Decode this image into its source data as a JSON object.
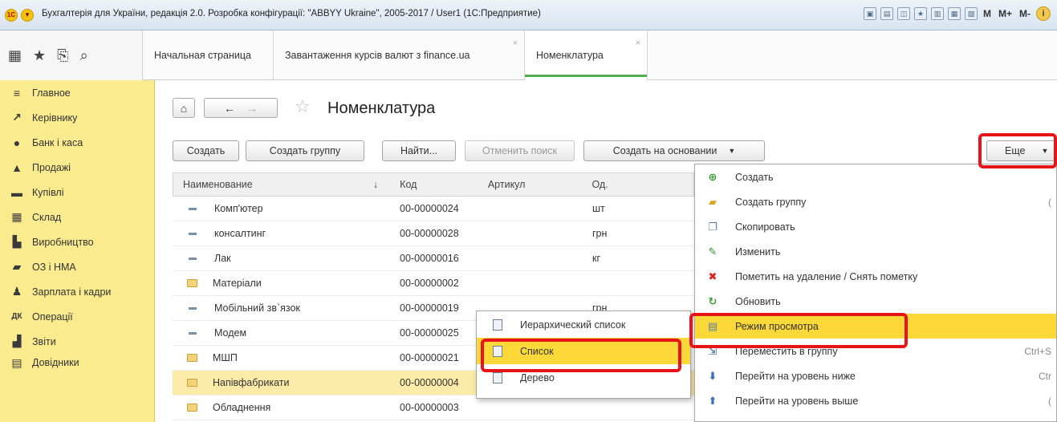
{
  "window": {
    "title": "Бухгалтерія для України, редакція 2.0. Розробка конфігурації: \"ABBYY Ukraine\", 2005-2017 / User1  (1С:Предприятие)",
    "logo_text": "1С",
    "toolbar_text": [
      "M",
      "M+",
      "M-"
    ],
    "info_icon": "i"
  },
  "tabs": [
    {
      "label": "Начальная страница",
      "closable": false
    },
    {
      "label": "Завантаження курсів валют з finance.ua",
      "closable": true
    },
    {
      "label": "Номенклатура",
      "closable": true,
      "active": true
    }
  ],
  "tab_close": "×",
  "sidebar": {
    "items": [
      {
        "label": "Главное",
        "icon": "menu-icon"
      },
      {
        "label": "Керівнику",
        "icon": "chart-icon"
      },
      {
        "label": "Банк і каса",
        "icon": "bank-icon"
      },
      {
        "label": "Продажі",
        "icon": "shopping-bag-icon"
      },
      {
        "label": "Купівлі",
        "icon": "cart-icon"
      },
      {
        "label": "Склад",
        "icon": "warehouse-icon"
      },
      {
        "label": "Виробництво",
        "icon": "factory-icon"
      },
      {
        "label": "ОЗ і НМА",
        "icon": "truck-icon"
      },
      {
        "label": "Зарплата і кадри",
        "icon": "person-icon"
      },
      {
        "label": "Операції",
        "icon": "operations-icon"
      },
      {
        "label": "Звіти",
        "icon": "report-icon"
      },
      {
        "label": "Довідники",
        "icon": "book-icon"
      }
    ]
  },
  "page": {
    "title": "Номенклатура",
    "home_glyph": "⌂",
    "back_glyph": "←",
    "forward_glyph": "→",
    "star_glyph": "☆"
  },
  "toolbar": {
    "create": "Создать",
    "create_group": "Создать группу",
    "find": "Найти...",
    "cancel_search": "Отменить поиск",
    "create_based_on": "Создать на основании",
    "more": "Еще",
    "dropdown_glyph": "▼"
  },
  "table": {
    "columns": {
      "name": "Наименование",
      "sort_glyph": "↓",
      "code": "Код",
      "article": "Артикул",
      "unit": "Од."
    },
    "rows": [
      {
        "type": "item",
        "name": "Комп'ютер",
        "code": "00-00000024",
        "article": "",
        "unit": "шт"
      },
      {
        "type": "item",
        "name": "консалтинг",
        "code": "00-00000028",
        "article": "",
        "unit": "грн"
      },
      {
        "type": "item",
        "name": "Лак",
        "code": "00-00000016",
        "article": "",
        "unit": "кг"
      },
      {
        "type": "folder",
        "name": "Матеріали",
        "code": "00-00000002",
        "article": "",
        "unit": ""
      },
      {
        "type": "item",
        "name": "Мобільний зв`язок",
        "code": "00-00000019",
        "article": "",
        "unit": "грн"
      },
      {
        "type": "item",
        "name": "Модем",
        "code": "00-00000025",
        "article": "",
        "unit": ""
      },
      {
        "type": "folder",
        "name": "МШП",
        "code": "00-00000021",
        "article": "",
        "unit": ""
      },
      {
        "type": "folder",
        "name": "Напівфабрикати",
        "code": "00-00000004",
        "article": "",
        "unit": "",
        "selected": true
      },
      {
        "type": "folder",
        "name": "Обладнення",
        "code": "00-00000003",
        "article": "",
        "unit": ""
      }
    ]
  },
  "view_menu": {
    "items": [
      {
        "label": "Иерархический список"
      },
      {
        "label": "Список",
        "highlighted": true
      },
      {
        "label": "Дерево"
      }
    ]
  },
  "more_menu": {
    "items": [
      {
        "label": "Создать",
        "icon": "plus-circle-icon",
        "glyph": "⊕",
        "color": "#3b9b3b",
        "shortcut": ""
      },
      {
        "label": "Создать группу",
        "icon": "folder-add-icon",
        "glyph": "▰",
        "color": "#d8a629",
        "shortcut": "("
      },
      {
        "label": "Скопировать",
        "icon": "copy-icon",
        "glyph": "❐",
        "color": "#5d7fa6",
        "shortcut": ""
      },
      {
        "label": "Изменить",
        "icon": "pencil-icon",
        "glyph": "✎",
        "color": "#3b8a3b",
        "shortcut": ""
      },
      {
        "label": "Пометить на удаление / Снять пометку",
        "icon": "delete-mark-icon",
        "glyph": "✖",
        "color": "#d22",
        "shortcut": ""
      },
      {
        "label": "Обновить",
        "icon": "refresh-icon",
        "glyph": "↻",
        "color": "#3b9b3b",
        "shortcut": ""
      },
      {
        "label": "Режим просмотра",
        "icon": "view-mode-icon",
        "glyph": "▤",
        "color": "#5d7fa6",
        "shortcut": "",
        "highlighted": true
      },
      {
        "label": "Переместить в группу",
        "icon": "move-icon",
        "glyph": "⇲",
        "color": "#5d7fa6",
        "shortcut": "Ctrl+S"
      },
      {
        "label": "Перейти на уровень ниже",
        "icon": "level-down-icon",
        "glyph": "⬇",
        "color": "#3b6fb0",
        "shortcut": "Ctr"
      },
      {
        "label": "Перейти на уровень выше",
        "icon": "level-up-icon",
        "glyph": "⬆",
        "color": "#3b6fb0",
        "shortcut": "("
      }
    ]
  },
  "colors": {
    "sidebar_bg": "#fbeb8f",
    "highlight": "#fcd838",
    "selected_row": "#fbeaa8",
    "annotation_red": "#e8141b",
    "active_tab_accent": "#4caf50"
  }
}
